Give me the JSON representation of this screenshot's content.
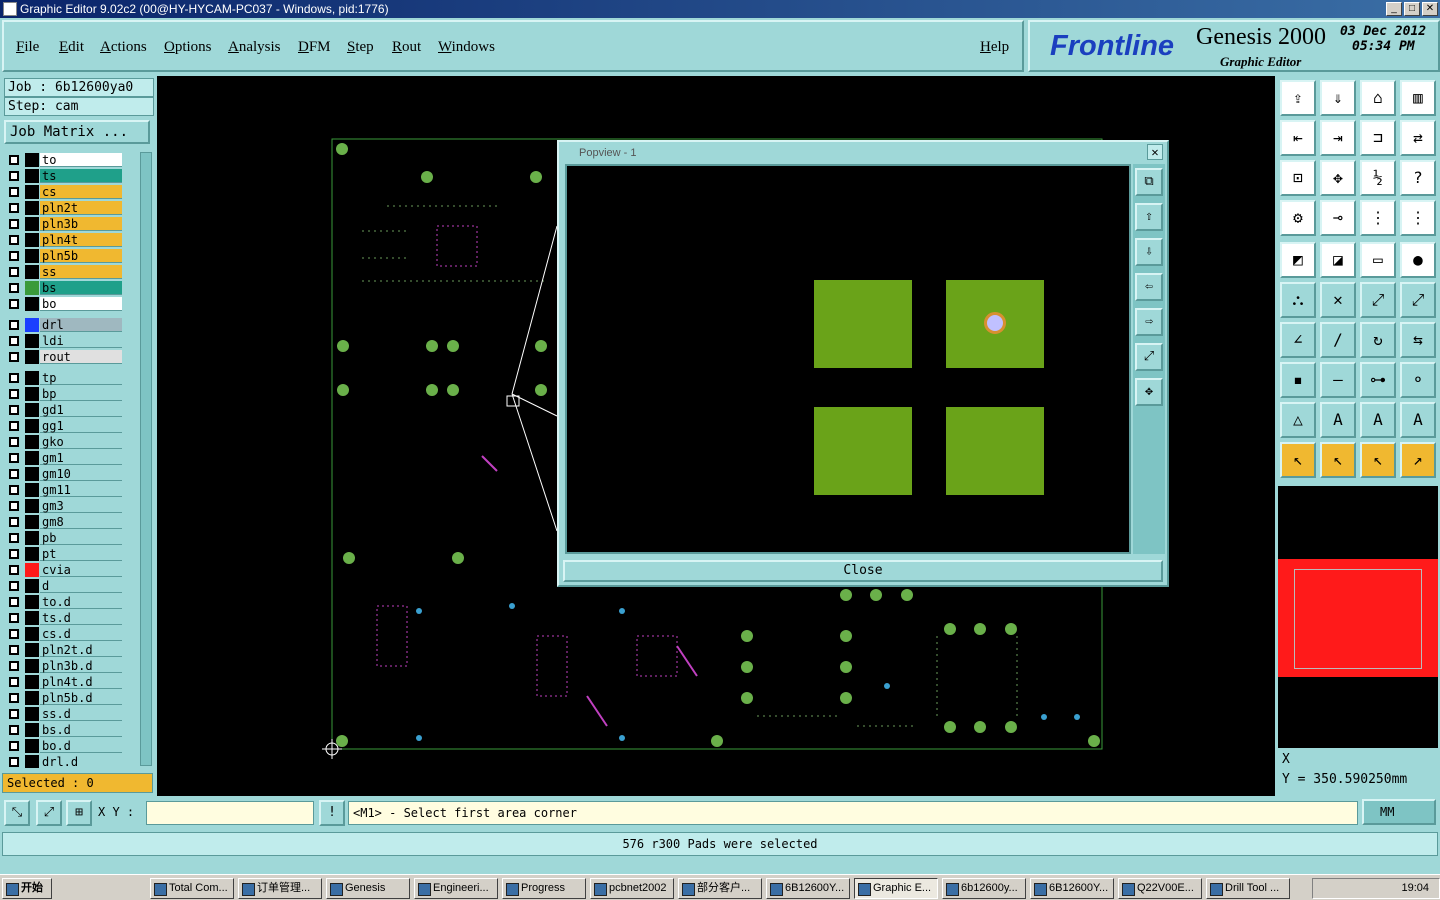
{
  "window": {
    "title": "Graphic Editor 9.02c2 (00@HY-HYCAM-PC037 - Windows, pid:1776)",
    "min": "_",
    "max": "□",
    "close": "✕"
  },
  "menu": [
    "File",
    "Edit",
    "Actions",
    "Options",
    "Analysis",
    "DFM",
    "Step",
    "Rout",
    "Windows"
  ],
  "help": "Help",
  "logo": {
    "brand": "Frontline",
    "product": "Genesis 2000",
    "subtitle": "Graphic Editor",
    "date": "03 Dec 2012",
    "time": "05:34 PM"
  },
  "job": {
    "job_line": "Job : 6b12600ya0",
    "step_line": "Step: cam",
    "matrix_button": "Job Matrix ..."
  },
  "layers": [
    {
      "name": "to",
      "color": "#ffffff",
      "swatch": "#000000"
    },
    {
      "name": "ts",
      "color": "#1fa08a",
      "swatch": "#000000"
    },
    {
      "name": "cs",
      "color": "#f0b830",
      "swatch": "#000000"
    },
    {
      "name": "pln2t",
      "color": "#f0b830",
      "swatch": "#000000"
    },
    {
      "name": "pln3b",
      "color": "#f0b830",
      "swatch": "#000000"
    },
    {
      "name": "pln4t",
      "color": "#f0b830",
      "swatch": "#000000"
    },
    {
      "name": "pln5b",
      "color": "#f0b830",
      "swatch": "#000000"
    },
    {
      "name": "ss",
      "color": "#f0b830",
      "swatch": "#000000"
    },
    {
      "name": "bs",
      "color": "#1fa08a",
      "swatch": "#3a9a3a"
    },
    {
      "name": "bo",
      "color": "#ffffff",
      "swatch": "#000000"
    }
  ],
  "drill_layers": [
    {
      "name": "drl",
      "color": "#9fb8c0",
      "swatch": "#1a3fff"
    },
    {
      "name": "ldi",
      "color": "#9fd8d8",
      "swatch": "#000000"
    },
    {
      "name": "rout",
      "color": "#e0e0e0",
      "swatch": "#000000"
    }
  ],
  "misc_layers": [
    "tp",
    "bp",
    "gd1",
    "gg1",
    "gko",
    "gm1",
    "gm10",
    "gm11",
    "gm3",
    "gm8",
    "pb",
    "pt",
    "cvia",
    "d",
    "to.d",
    "ts.d",
    "cs.d",
    "pln2t.d",
    "pln3b.d",
    "pln4t.d",
    "pln5b.d",
    "ss.d",
    "bs.d",
    "bo.d",
    "drl.d"
  ],
  "selected": "Selected : 0",
  "popup": {
    "title": "Popview - 1",
    "close_label": "Close",
    "close_x": "✕"
  },
  "coords": {
    "x": "X",
    "y": "Y = 350.590250mm"
  },
  "command": {
    "xy_label": "X Y :",
    "xy_value": "",
    "prompt": "<M1> - Select first area corner",
    "unit": "MM"
  },
  "status": "576 r300 Pads were selected",
  "taskbar": {
    "start": "开始",
    "tasks": [
      "Total Com...",
      "订单管理...",
      "Genesis",
      "Engineeri...",
      "Progress",
      "pcbnet2002",
      "部分客户...",
      "6B12600Y...",
      "Graphic E...",
      "6b12600y...",
      "6B12600Y...",
      "Q22V00E...",
      "Drill Tool ..."
    ],
    "clock": "19:04"
  }
}
